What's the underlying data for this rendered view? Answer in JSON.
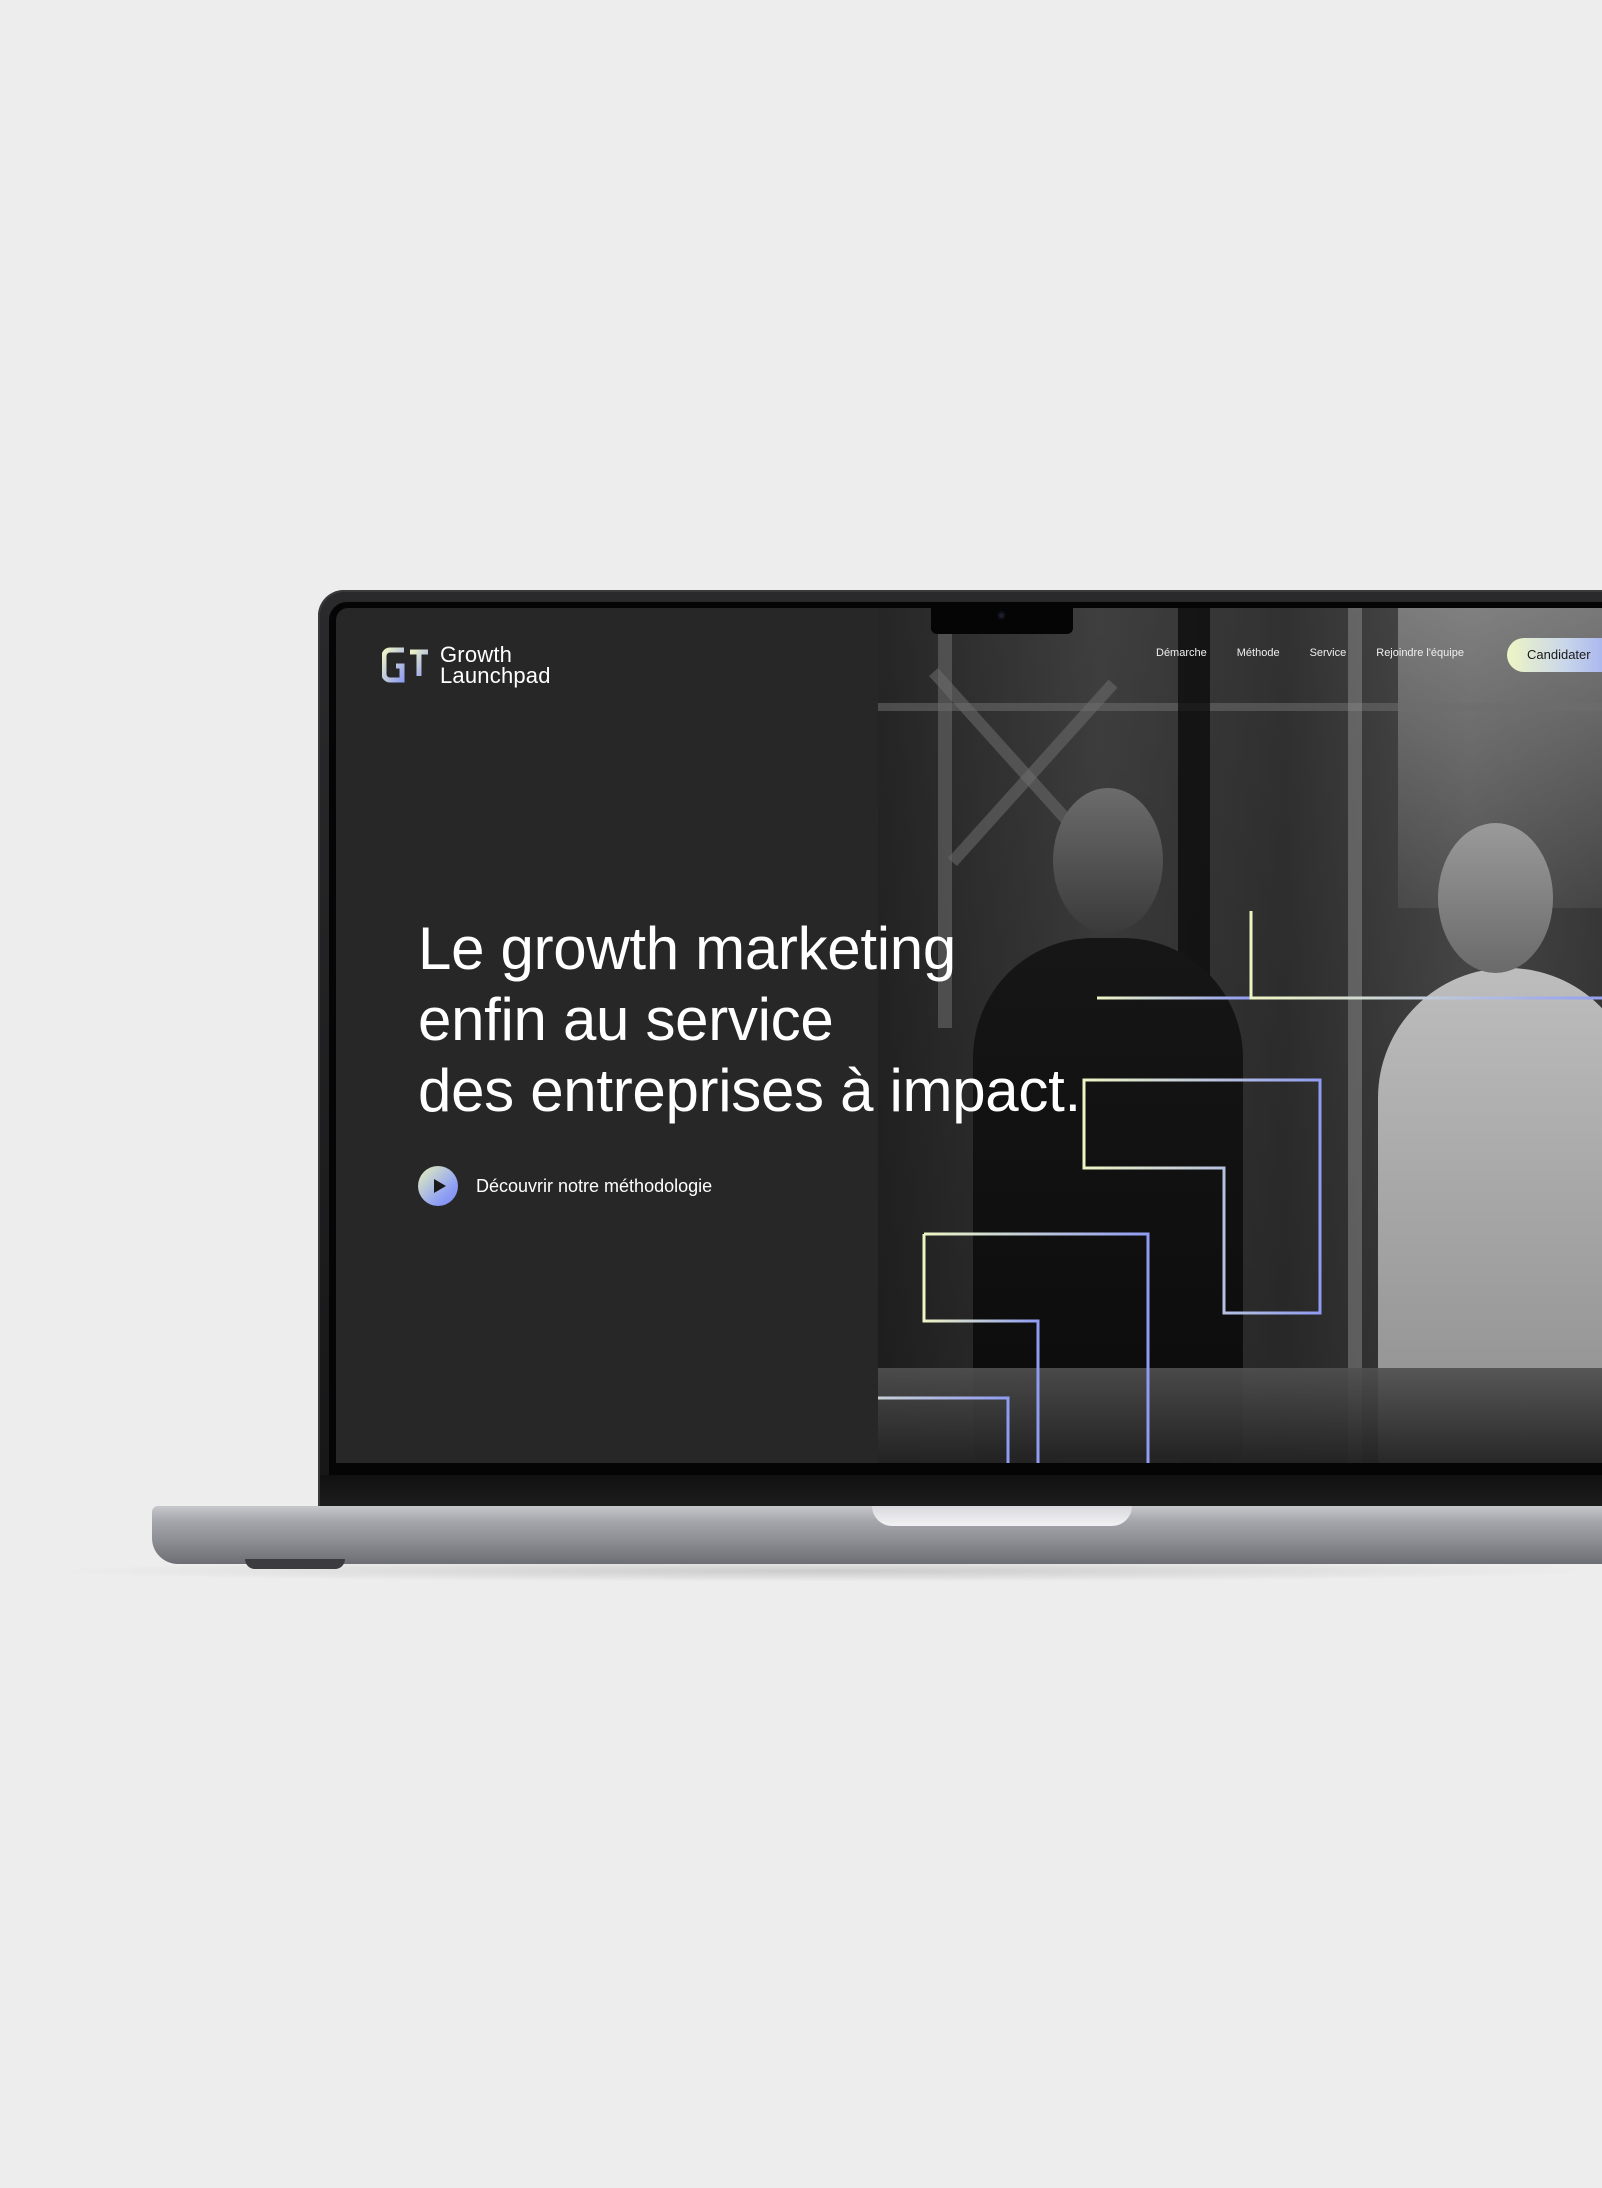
{
  "brand": {
    "line1": "Growth",
    "line2": "Launchpad"
  },
  "nav": {
    "items": [
      "Démarche",
      "Méthode",
      "Service",
      "Rejoindre l'équipe"
    ],
    "cta_label": "Candidater"
  },
  "hero": {
    "headline_lines": [
      "Le growth marketing",
      "enfin au service",
      "des entreprises à impact."
    ],
    "discover_label": "Découvrir notre méthodologie"
  },
  "colors": {
    "page_background": "#ededed",
    "site_background": "#272727",
    "accent_lime": "#eef5c4",
    "accent_periwinkle": "#8f9cf2"
  },
  "icons": {
    "logo": "growth-launchpad-logo-icon",
    "play": "play-icon"
  }
}
